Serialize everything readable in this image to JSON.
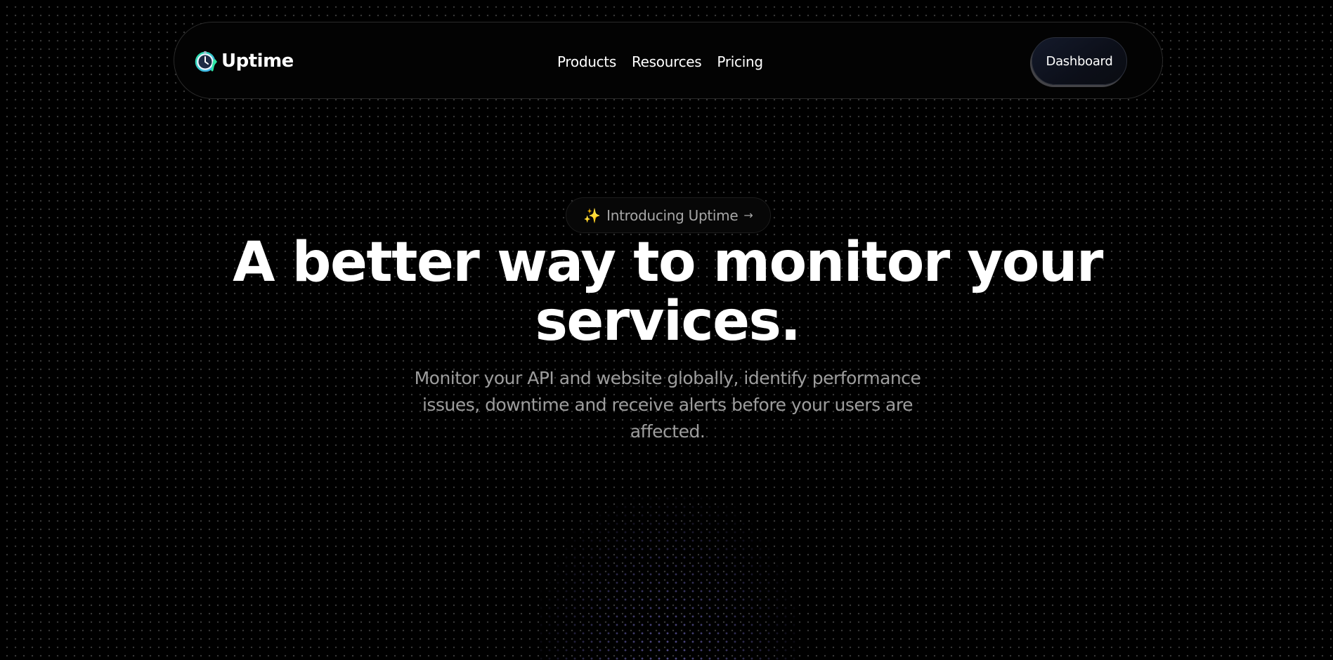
{
  "header": {
    "brand_name": "Uptime",
    "logo_icon": "stopwatch-arrow-icon",
    "nav": [
      {
        "label": "Products"
      },
      {
        "label": "Resources"
      },
      {
        "label": "Pricing"
      }
    ],
    "dashboard_label": "Dashboard"
  },
  "hero": {
    "badge_icon": "sparkles-icon",
    "badge_text": "Introducing Uptime",
    "badge_arrow_icon": "arrow-right-icon",
    "headline_line1": "A better way to monitor your",
    "headline_line2": "services.",
    "subheadline": "Monitor your API and website globally, identify performance issues, downtime and receive alerts before your users are affected."
  },
  "colors": {
    "background": "#000000",
    "text_primary": "#ffffff",
    "text_muted": "#9d9d9d",
    "accent_glow": "#968cff",
    "logo_accent": "#2ee6a6"
  }
}
